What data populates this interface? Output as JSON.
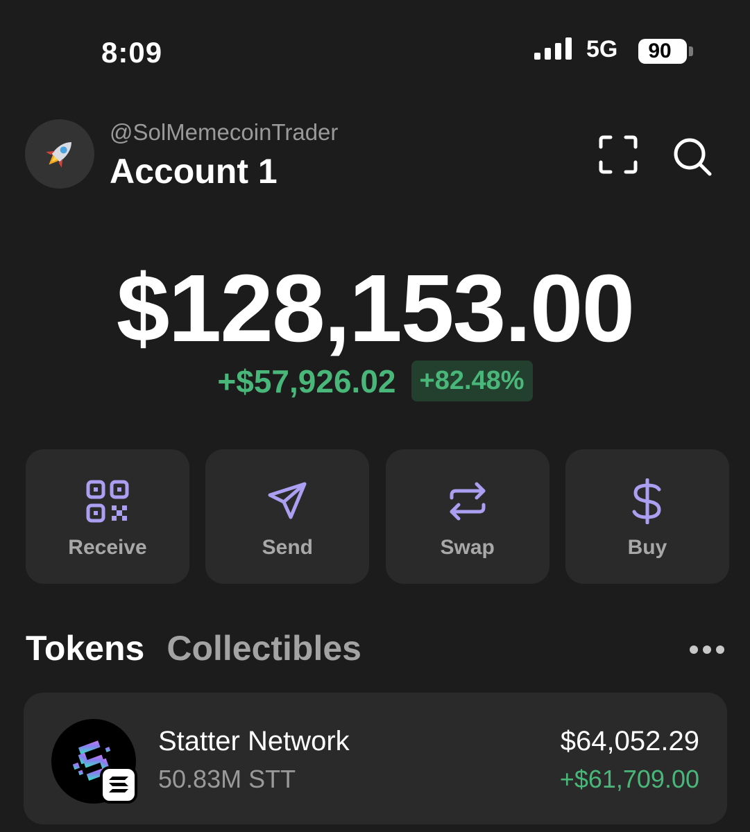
{
  "status_bar": {
    "time": "8:09",
    "network": "5G",
    "battery": "90"
  },
  "header": {
    "handle": "@SolMemecoinTrader",
    "account_name": "Account 1",
    "avatar_icon": "rocket-icon"
  },
  "balance": {
    "total": "$128,153.00",
    "change_amount": "+$57,926.02",
    "change_percent": "+82.48%"
  },
  "actions": [
    {
      "label": "Receive",
      "icon": "qr-code-icon"
    },
    {
      "label": "Send",
      "icon": "send-icon"
    },
    {
      "label": "Swap",
      "icon": "swap-icon"
    },
    {
      "label": "Buy",
      "icon": "dollar-icon"
    }
  ],
  "tabs": {
    "tokens": "Tokens",
    "collectibles": "Collectibles"
  },
  "tokens": [
    {
      "name": "Statter Network",
      "amount": "50.83M STT",
      "value": "$64,052.29",
      "change": "+$61,709.00"
    }
  ],
  "colors": {
    "background": "#1c1c1c",
    "card": "#2a2a2a",
    "accent": "#ab9ff2",
    "positive": "#4ab77a"
  }
}
